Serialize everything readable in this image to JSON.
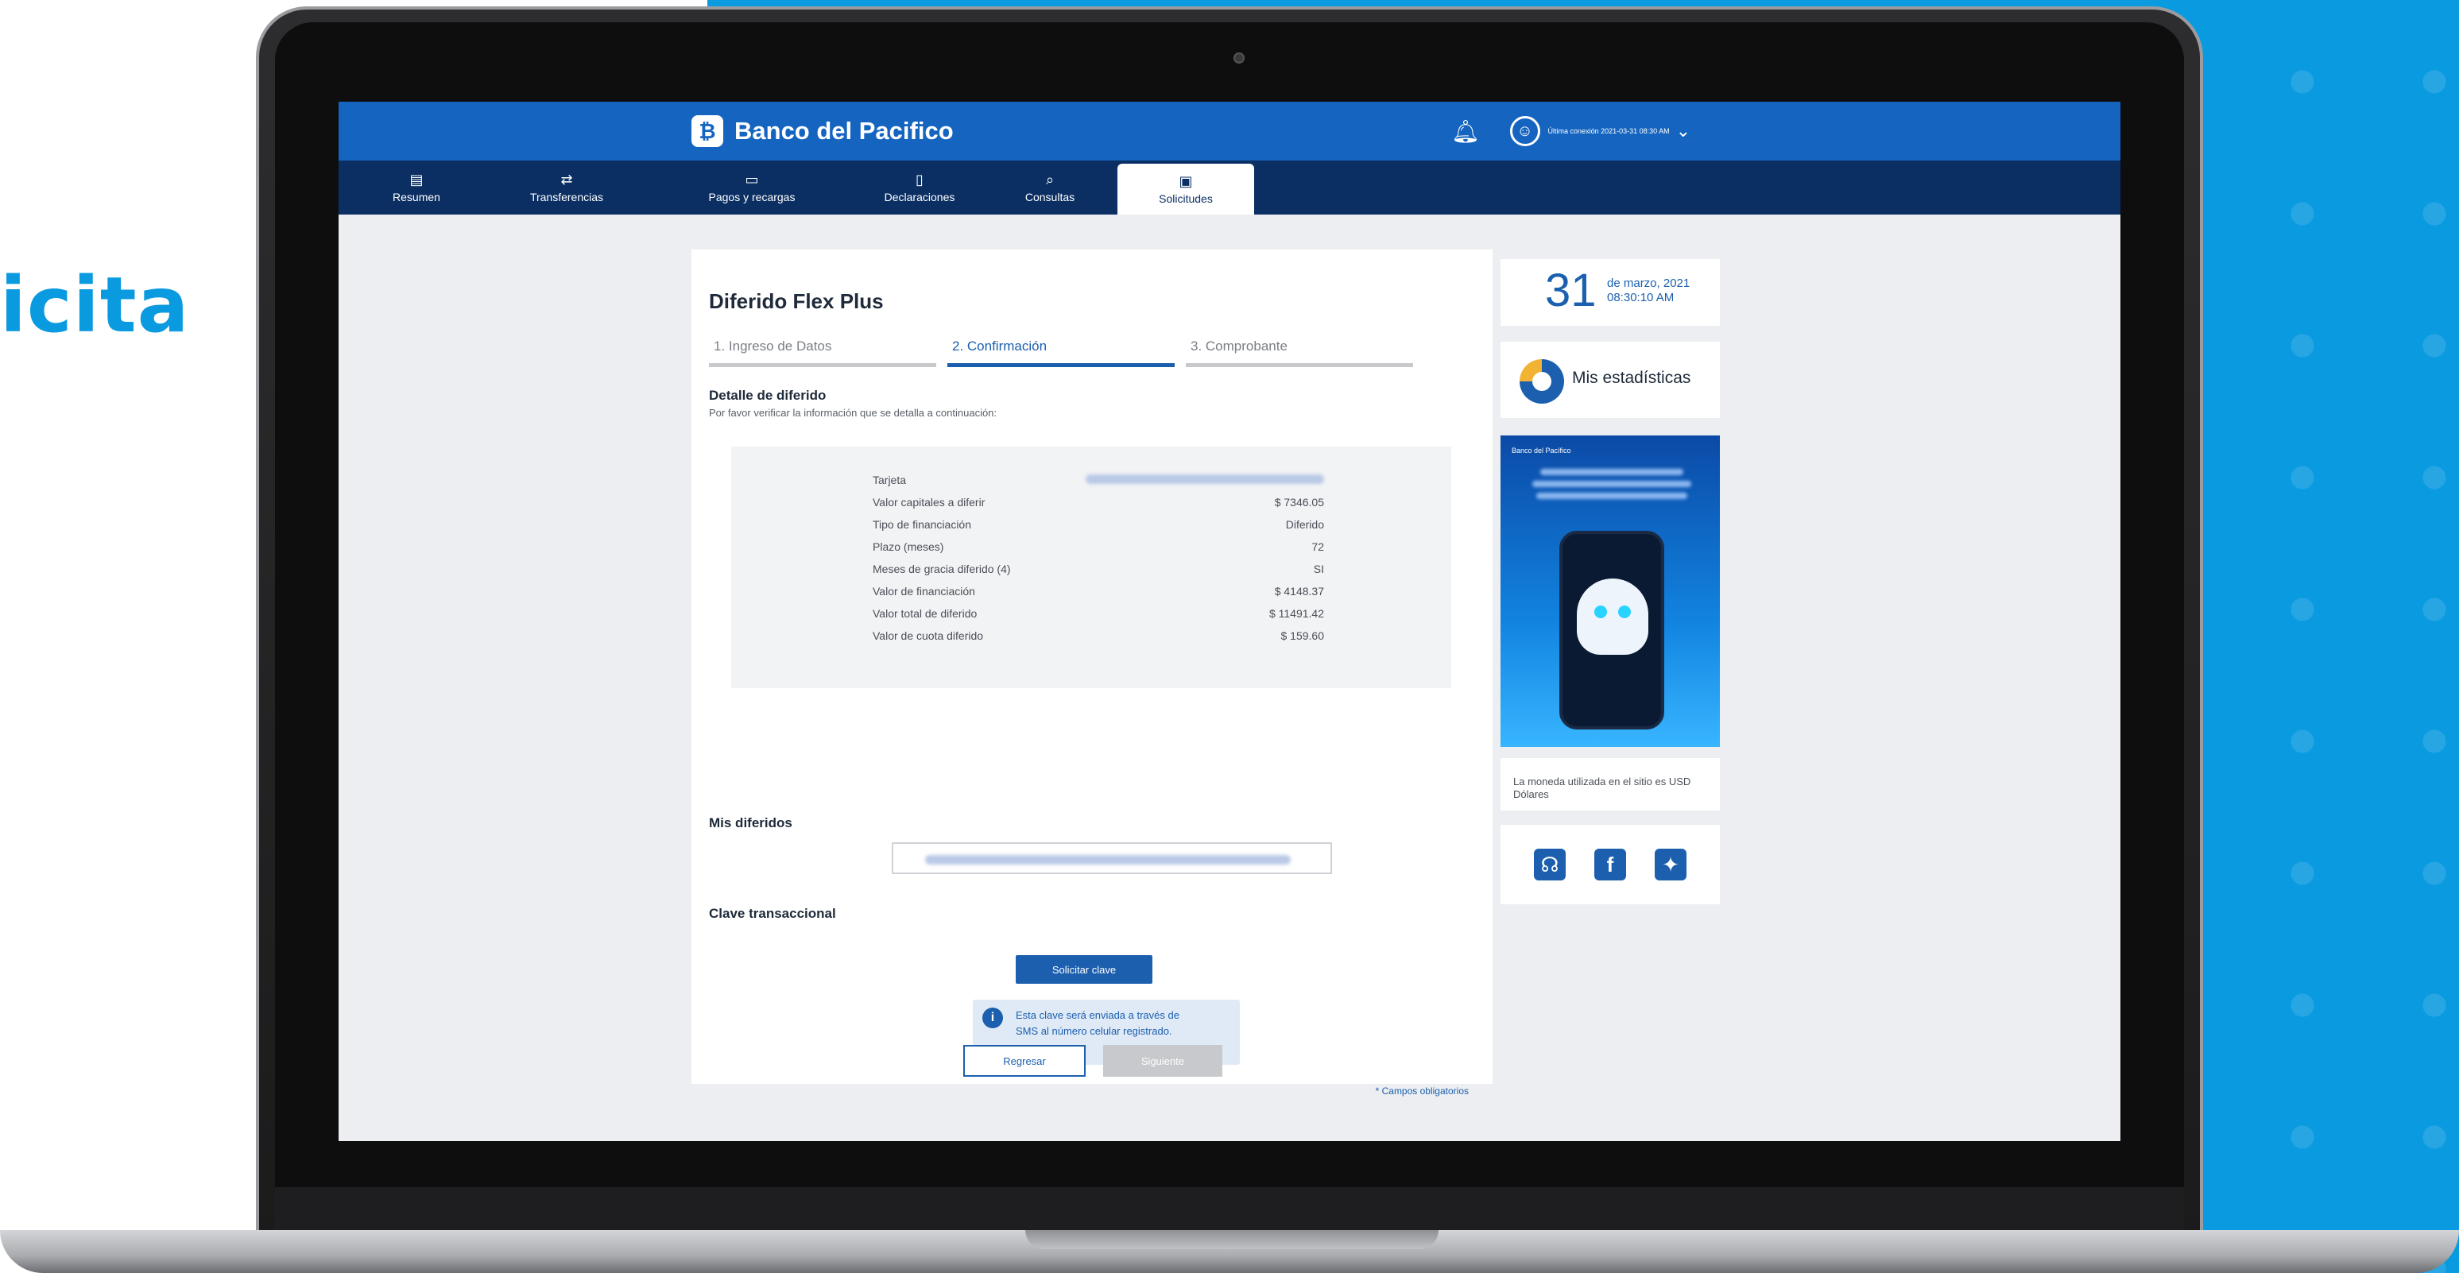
{
  "promo": {
    "text": "icita"
  },
  "header": {
    "brand": "Banco del Pacifico",
    "last_login": "Última conexión 2021-03-31 08:30 AM"
  },
  "nav": {
    "items": [
      {
        "label": "Resumen",
        "icon": "summary-icon"
      },
      {
        "label": "Transferencias",
        "icon": "transfer-icon"
      },
      {
        "label": "Pagos y recargas",
        "icon": "payments-icon"
      },
      {
        "label": "Declaraciones",
        "icon": "declarations-icon"
      },
      {
        "label": "Consultas",
        "icon": "search-icon"
      },
      {
        "label": "Solicitudes",
        "icon": "requests-icon",
        "active": true
      }
    ]
  },
  "main": {
    "title": "Diferido Flex Plus",
    "steps": [
      "1. Ingreso de Datos",
      "2. Confirmación",
      "3. Comprobante"
    ],
    "active_step": 2,
    "detail_title": "Detalle de diferido",
    "detail_sub": "Por favor verificar la información que se detalla a continuación:",
    "details": [
      {
        "label": "Tarjeta",
        "value": ""
      },
      {
        "label": "Valor capitales a diferir",
        "value": "$ 7346.05"
      },
      {
        "label": "Tipo de financiación",
        "value": "Diferido"
      },
      {
        "label": "Plazo (meses)",
        "value": "72"
      },
      {
        "label": "Meses de gracia diferido (4)",
        "value": "SI"
      },
      {
        "label": "Valor de financiación",
        "value": "$ 4148.37"
      },
      {
        "label": "Valor total de diferido",
        "value": "$ 11491.42"
      },
      {
        "label": "Valor de cuota diferido",
        "value": "$ 159.60"
      }
    ],
    "mis_diferidos_title": "Mis diferidos",
    "clave_title": "Clave transaccional",
    "solicitar_label": "Solicitar clave",
    "info_text_1": "Esta clave será enviada a través de",
    "info_text_2": "SMS al número celular registrado.",
    "required_note": "* Campos obligatorios",
    "back_label": "Regresar",
    "next_label": "Siguiente"
  },
  "side": {
    "day": "31",
    "month_year": "de marzo, 2021",
    "time": "08:30:10 AM",
    "stats_label": "Mis estadísticas",
    "banner_brand": "Banco del Pacífico",
    "currency_note": "La moneda utilizada en el sitio es USD Dólares",
    "social": [
      {
        "icon": "headset-icon",
        "color": "#1b5fae"
      },
      {
        "icon": "facebook-icon",
        "color": "#1b5fae"
      },
      {
        "icon": "twitter-icon",
        "color": "#1b5fae"
      }
    ]
  }
}
